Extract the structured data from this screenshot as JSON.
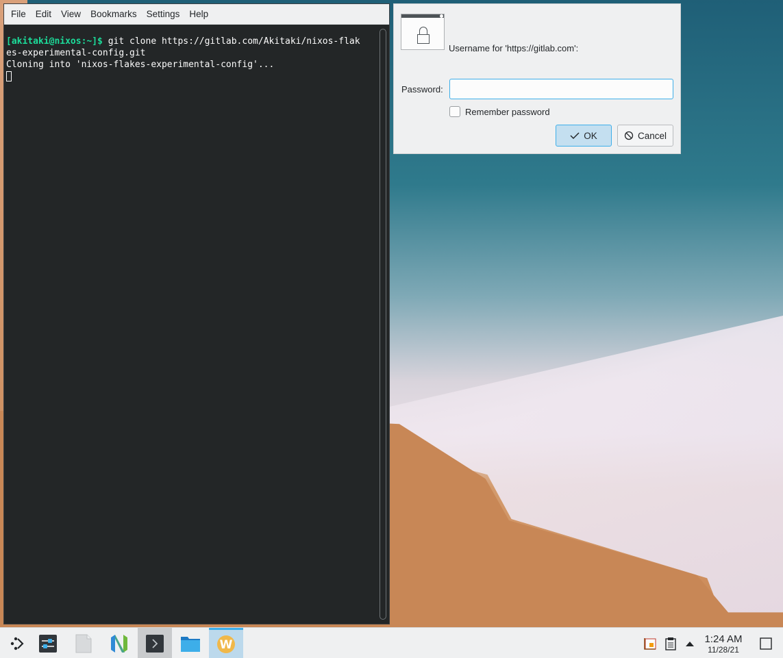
{
  "terminal": {
    "menu": [
      "File",
      "Edit",
      "View",
      "Bookmarks",
      "Settings",
      "Help"
    ],
    "prompt": "[akitaki@nixos:~]$",
    "command": " git clone https://gitlab.com/Akitaki/nixos-flak",
    "command_wrap": "es-experimental-config.git",
    "output": "Cloning into 'nixos-flakes-experimental-config'..."
  },
  "dialog": {
    "prompt": "Username for 'https://gitlab.com':",
    "password_label": "Password:",
    "password_value": "",
    "remember_label": "Remember password",
    "remember_checked": false,
    "ok_label": "OK",
    "cancel_label": "Cancel"
  },
  "taskbar": {
    "apps": [
      "application-launcher-icon",
      "system-settings-icon",
      "text-file-icon",
      "neovim-icon",
      "terminal-icon",
      "file-manager-icon",
      "wine-icon"
    ],
    "clock_time": "1:24 AM",
    "clock_date": "11/28/21"
  },
  "colors": {
    "accent": "#3daee9",
    "terminal_bg": "#232627",
    "prompt_green": "#1cdc9a"
  }
}
